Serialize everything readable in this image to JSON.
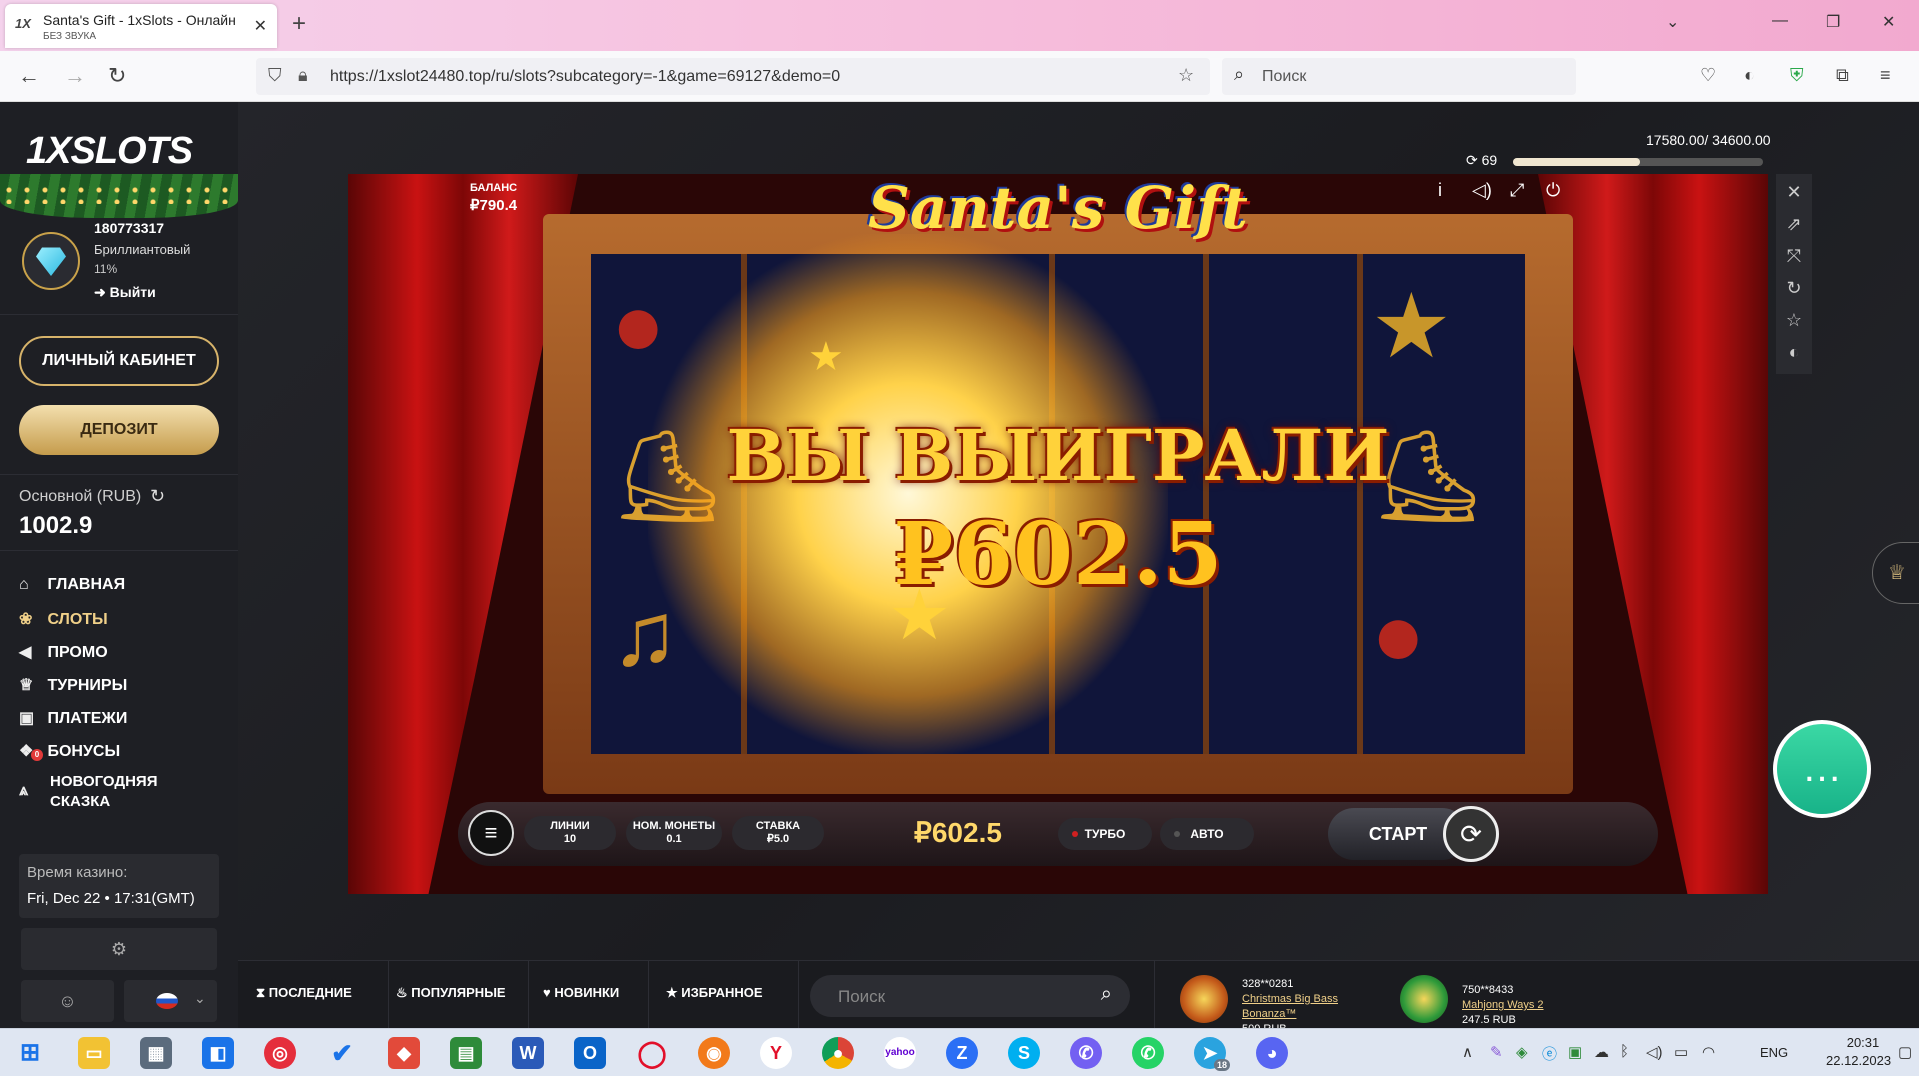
{
  "browser": {
    "tab_title": "Santa's Gift - 1xSlots - Онлайн",
    "tab_subtitle": "БЕЗ ЗВУКА",
    "tab_favicon": "1X",
    "url": "https://1xslot24480.top/ru/slots?subcategory=-1&game=69127&demo=0",
    "search_placeholder": "Поиск"
  },
  "sidebar": {
    "logo": "1XSLOTS",
    "user_id": "180773317",
    "user_level": "Бриллиантовый",
    "user_progress": "11%",
    "logout_label": "Выйти",
    "cabinet_button": "ЛИЧНЫЙ КАБИНЕТ",
    "deposit_button": "ДЕПОЗИТ",
    "balance_label": "Основной (RUB)",
    "balance_value": "1002.9",
    "menu": [
      {
        "label": "ГЛАВНАЯ",
        "icon": "home-icon"
      },
      {
        "label": "СЛОТЫ",
        "icon": "slots-icon"
      },
      {
        "label": "ПРОМО",
        "icon": "megaphone-icon"
      },
      {
        "label": "ТУРНИРЫ",
        "icon": "trophy-icon"
      },
      {
        "label": "ПЛАТЕЖИ",
        "icon": "wallet-icon"
      },
      {
        "label": "БОНУСЫ",
        "icon": "gift-icon",
        "badge": "0"
      },
      {
        "label_line1": "НОВОГОДНЯЯ",
        "label_line2": "СКАЗКА",
        "icon": "tree-icon"
      }
    ],
    "casino_time_label": "Время казино:",
    "casino_time_value": "Fri, Dec 22 • 17:31(GMT)"
  },
  "main": {
    "progress_text": "17580.00/ 34600.00",
    "progress_fraction": 0.508,
    "progress_count": "69"
  },
  "game": {
    "title": "Santa's Gift",
    "balance_label": "БАЛАНС",
    "balance_value": "₽790.4",
    "win_title": "ВЫ ВЫИГРАЛИ",
    "win_amount": "₽602.5",
    "lines_label": "ЛИНИИ",
    "lines_value": "10",
    "coin_label": "НОМ. МОНЕТЫ",
    "coin_value": "0.1",
    "bet_label": "СТАВКА",
    "bet_value": "₽5.0",
    "bar_win": "₽602.5",
    "turbo_label": "ТУРБО",
    "auto_label": "АВТО",
    "start_label": "СТАРТ"
  },
  "strip": {
    "tabs": [
      "ПОСЛЕДНИЕ",
      "ПОПУЛЯРНЫЕ",
      "НОВИНКИ",
      "ИЗБРАННОЕ"
    ],
    "search_placeholder": "Поиск",
    "winners": [
      {
        "user": "328**0281",
        "game_line1": "Christmas Big Bass",
        "game_line2": "Bonanza™",
        "amount": "500 RUB"
      },
      {
        "user": "750**8433",
        "game_line1": "Mahjong Ways 2",
        "amount": "247.5 RUB"
      }
    ]
  },
  "taskbar": {
    "lang": "ENG",
    "time": "20:31",
    "date": "22.12.2023",
    "telegram_badge": "18"
  },
  "colors": {
    "accent_gold": "#f0d089",
    "sidebar_bg": "#1e1f24",
    "chat_green": "#18b389"
  }
}
